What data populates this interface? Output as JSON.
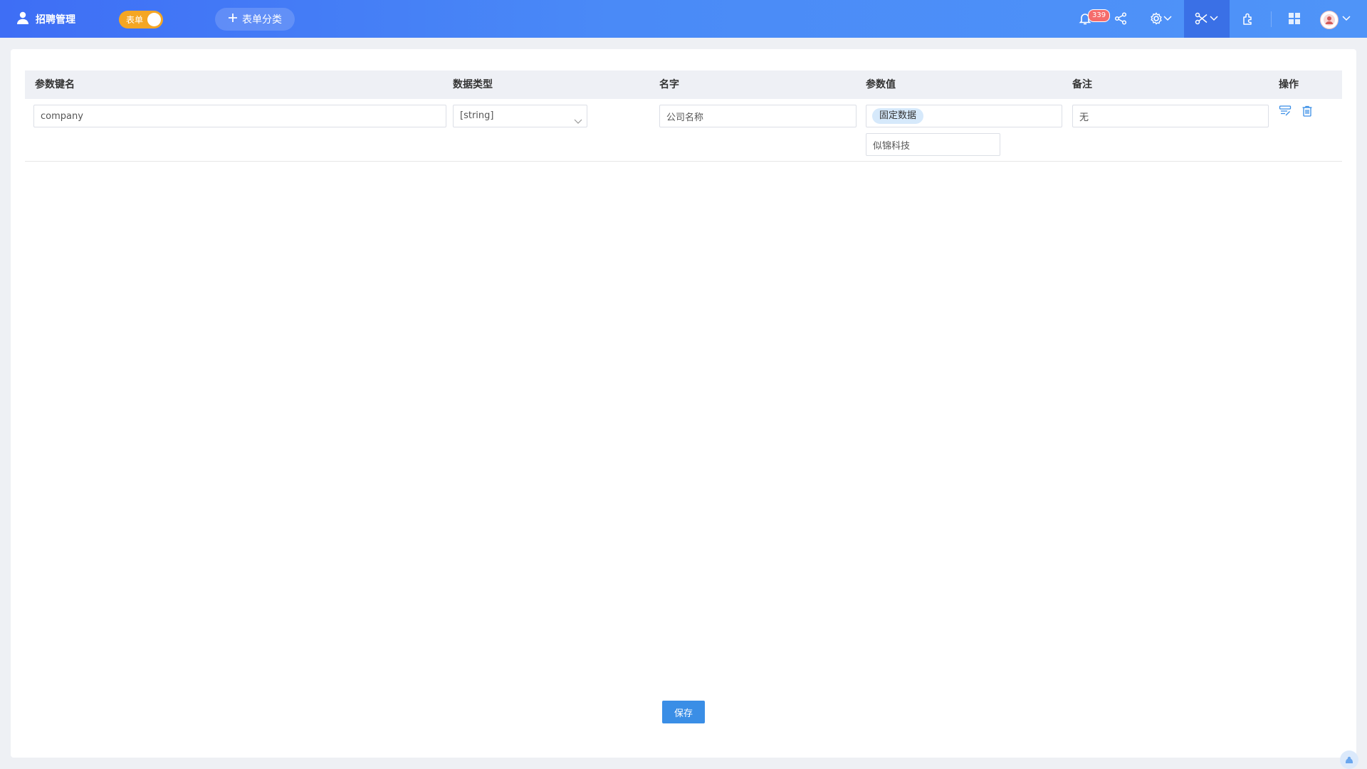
{
  "header": {
    "app_title": "招聘管理",
    "toggle_label": "表单",
    "add_category_label": "表单分类",
    "notification_count": "339",
    "icons": [
      "user-icon",
      "bell-icon",
      "share-icon",
      "settings-icon",
      "tools-icon",
      "plugin-icon",
      "apps-icon",
      "avatar",
      "chevron-down-icon"
    ]
  },
  "table": {
    "columns": [
      "参数键名",
      "数据类型",
      "名字",
      "参数值",
      "备注",
      "操作"
    ],
    "rows": [
      {
        "key": "company",
        "type": "[string]",
        "name": "公司名称",
        "value_tag": "固定数据",
        "value": "似锦科技",
        "remark": "无"
      }
    ]
  },
  "footer": {
    "save_label": "保存"
  },
  "colors": {
    "header_start": "#3e6ef5",
    "header_end": "#4f94f8",
    "toggle": "#f5a623",
    "primary": "#3a8ee6",
    "badge": "#f56c6c"
  }
}
